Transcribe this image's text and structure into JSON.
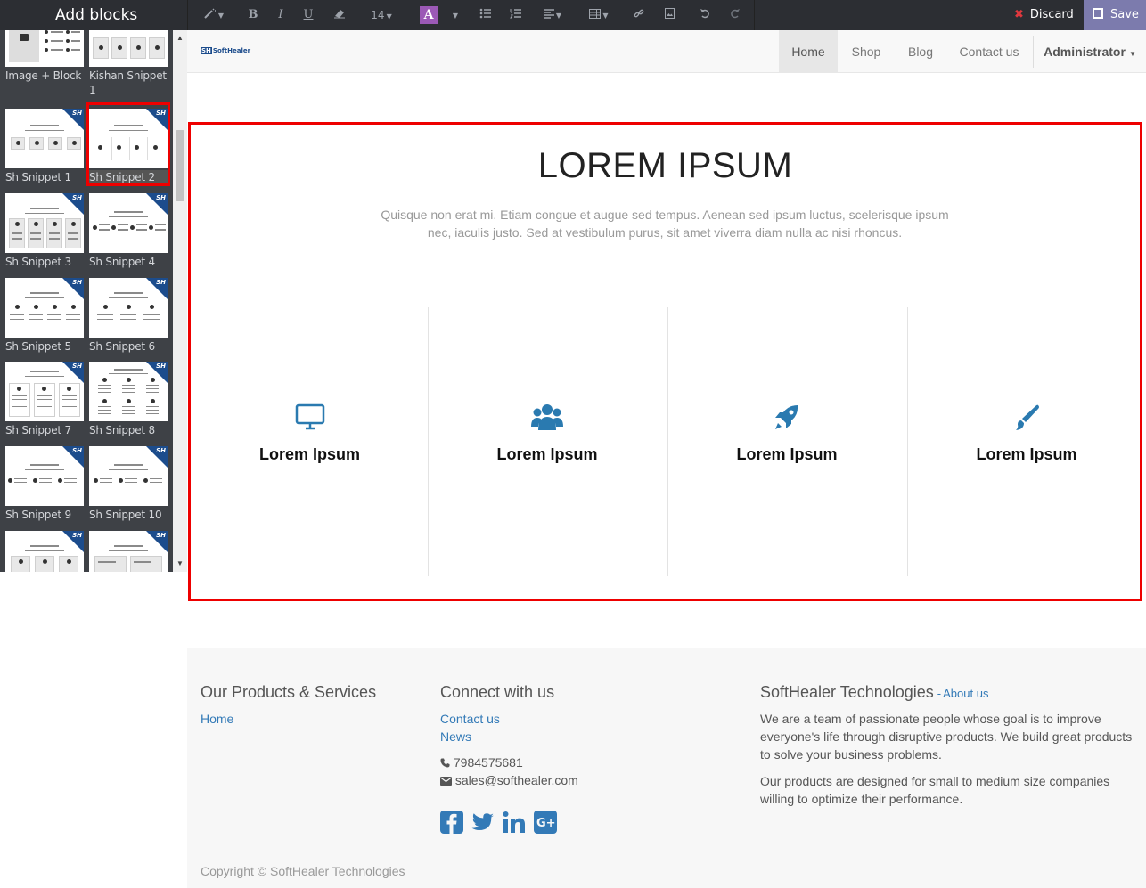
{
  "sidebar": {
    "title": "Add blocks",
    "snippets": [
      {
        "label": "Image + Block"
      },
      {
        "label": "Kishan Snippet 1"
      },
      {
        "label": "Sh Snippet 1"
      },
      {
        "label": "Sh Snippet 2"
      },
      {
        "label": "Sh Snippet 3"
      },
      {
        "label": "Sh Snippet 4"
      },
      {
        "label": "Sh Snippet 5"
      },
      {
        "label": "Sh Snippet 6"
      },
      {
        "label": "Sh Snippet 7"
      },
      {
        "label": "Sh Snippet 8"
      },
      {
        "label": "Sh Snippet 9"
      },
      {
        "label": "Sh Snippet 10"
      }
    ],
    "badge_text": "SH",
    "selected_snippet": "Sh Snippet 2"
  },
  "toolbar": {
    "font_size": "14",
    "color_letter": "A",
    "discard_label": "Discard",
    "save_label": "Save",
    "save_bg": "#7c7bad",
    "discard_icon_color": "#e0383e",
    "icons": [
      "magic-wand-icon",
      "bold-icon",
      "italic-icon",
      "underline-icon",
      "eraser-icon",
      "font-size-select",
      "text-color-icon",
      "unordered-list-icon",
      "ordered-list-icon",
      "align-icon",
      "table-icon",
      "link-icon",
      "image-icon",
      "undo-icon",
      "redo-icon"
    ]
  },
  "navbar": {
    "logo_text": "SoftHealer",
    "logo_mark": "SH",
    "items": [
      {
        "label": "Home",
        "active": true
      },
      {
        "label": "Shop"
      },
      {
        "label": "Blog"
      },
      {
        "label": "Contact us"
      }
    ],
    "user": "Administrator"
  },
  "block": {
    "title": "LOREM IPSUM",
    "subtitle_line1": "Quisque non erat mi. Etiam congue et augue sed tempus. Aenean sed ipsum luctus, scelerisque ipsum",
    "subtitle_line2": "nec, iaculis justo. Sed at vestibulum purus, sit amet viverra diam nulla ac nisi rhoncus.",
    "features": [
      {
        "title": "Lorem Ipsum",
        "icon": "monitor-icon"
      },
      {
        "title": "Lorem Ipsum",
        "icon": "users-icon"
      },
      {
        "title": "Lorem Ipsum",
        "icon": "rocket-icon"
      },
      {
        "title": "Lorem Ipsum",
        "icon": "paint-brush-icon"
      }
    ],
    "icon_color": "#2a7ab0",
    "highlight_color": "#e00000"
  },
  "footer": {
    "products_heading": "Our Products & Services",
    "products_links": [
      "Home"
    ],
    "connect_heading": "Connect with us",
    "connect_links": [
      "Contact us",
      "News"
    ],
    "phone": "7984575681",
    "email": "sales@softhealer.com",
    "company_heading": "SoftHealer Technologies",
    "about_link": "About us",
    "about_p1_lines": [
      "We are a team of passionate people whose goal is to improve",
      "everyone's life through disruptive products. We build great products",
      "to solve your business problems."
    ],
    "about_p2_lines": [
      "Our products are designed for small to medium size companies",
      "willing to optimize their performance."
    ],
    "social": [
      "facebook-icon",
      "twitter-icon",
      "linkedin-icon",
      "google-plus-icon"
    ],
    "copyright": "Copyright © SoftHealer Technologies"
  }
}
